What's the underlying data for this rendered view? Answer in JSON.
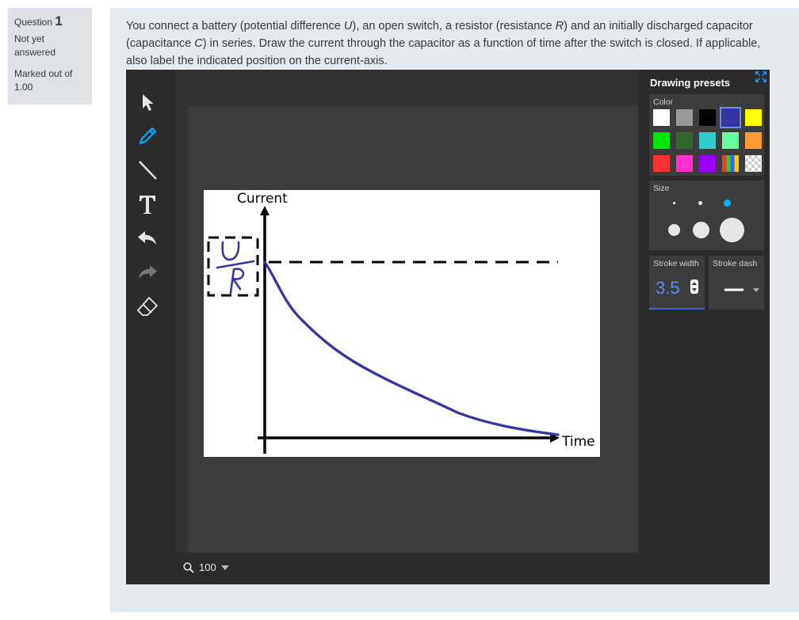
{
  "question_info": {
    "label": "Question",
    "number": "1",
    "state": "Not yet answered",
    "grade": "Marked out of 1.00"
  },
  "question": {
    "text_parts": [
      "You connect a battery (potential difference ",
      "U",
      "), an open switch, a resistor (resistance ",
      "R",
      ") and an initially discharged capacitor (capacitance ",
      "C",
      ") in series. Draw the current through the capacitor as a function of time after the switch is closed. If applicable, also label the indicated position on the current-axis."
    ]
  },
  "toolbar": {
    "tools": [
      {
        "name": "select-tool",
        "icon": "cursor-arrow-icon",
        "active": false
      },
      {
        "name": "pen-tool",
        "icon": "pencil-icon",
        "active": true
      },
      {
        "name": "line-tool",
        "icon": "line-icon",
        "active": false
      },
      {
        "name": "text-tool",
        "icon": "text-T-icon",
        "active": false
      },
      {
        "name": "undo-tool",
        "icon": "undo-icon",
        "active": false
      },
      {
        "name": "redo-tool",
        "icon": "redo-icon",
        "active": false,
        "disabled": true
      },
      {
        "name": "eraser-tool",
        "icon": "eraser-icon",
        "active": false
      }
    ]
  },
  "canvas": {
    "y_axis_label": "Current",
    "x_axis_label": "Time"
  },
  "bottom_bar": {
    "zoom_value": "100"
  },
  "presets": {
    "title": "Drawing presets",
    "color_label": "Color",
    "colors": [
      "#ffffff",
      "#999999",
      "#000000",
      "#3535a5",
      "#ffff00",
      "#00e600",
      "#2f6b2f",
      "#33cccc",
      "#66ff99",
      "#ff9933",
      "#ff3333",
      "#ff33cc",
      "#9900ff",
      "palette",
      "transparent"
    ],
    "selected_color": "#3535a5",
    "size_label": "Size",
    "selected_size": 3,
    "stroke_width_label": "Stroke width",
    "stroke_width_value": "3.5",
    "stroke_dash_label": "Stroke dash",
    "accent": "#00b4ff"
  }
}
